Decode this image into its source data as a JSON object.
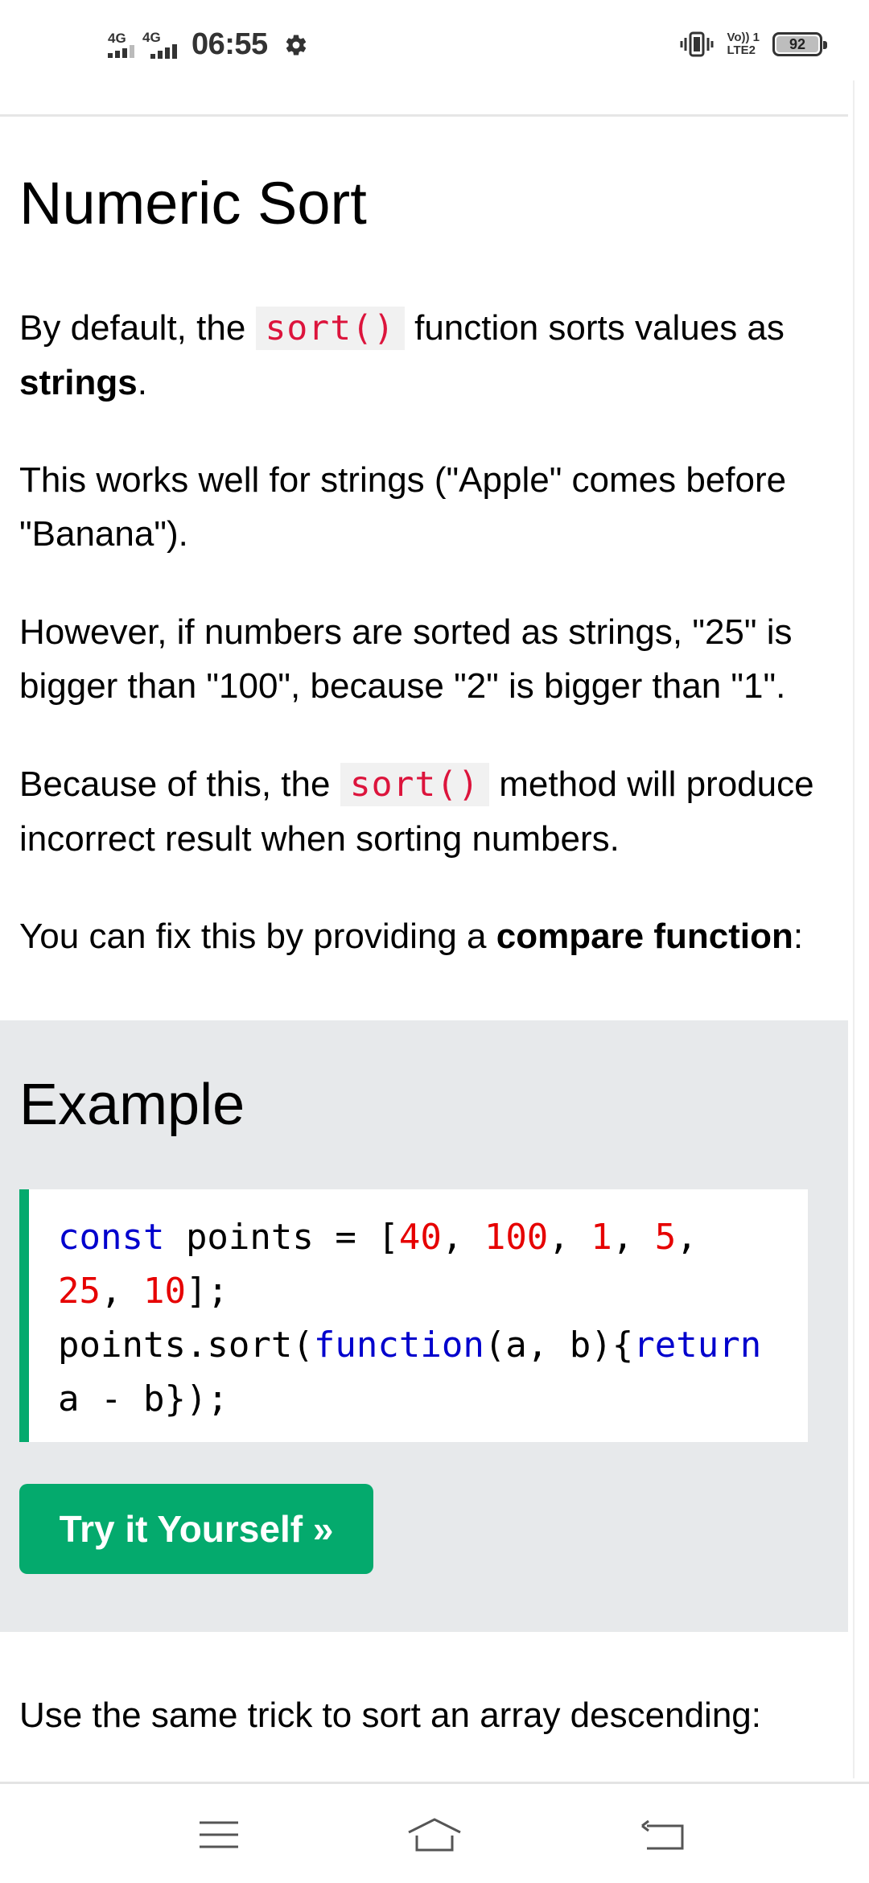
{
  "status_bar": {
    "network1": "4G",
    "network2": "4G",
    "time": "06:55",
    "volte": "Vo)) 1",
    "lte": "LTE2",
    "battery": "92"
  },
  "article": {
    "title": "Numeric Sort",
    "p1_before": "By default, the ",
    "p1_code": "sort()",
    "p1_after": " function sorts values as ",
    "p1_bold": "strings",
    "p1_end": ".",
    "p2": "This works well for strings (\"Apple\" comes before \"Banana\").",
    "p3": "However, if numbers are sorted as strings, \"25\" is bigger than \"100\", because \"2\" is bigger than \"1\".",
    "p4_before": "Because of this, the ",
    "p4_code": "sort()",
    "p4_after": " method will produce incorrect result when sorting numbers.",
    "p5_before": "You can fix this by providing a ",
    "p5_bold": "compare function",
    "p5_end": ":"
  },
  "example": {
    "heading": "Example",
    "code": {
      "kw_const": "const",
      "t_points": " points = [",
      "n40": "40",
      "c1": ", ",
      "n100": "100",
      "c2": ", ",
      "n1": "1",
      "c3": ", ",
      "n5": "5",
      "c4": ",",
      "n25": "25",
      "c5": ", ",
      "n10": "10",
      "t_end1": "];",
      "t_sort": "points.sort(",
      "kw_function": "function",
      "t_args": "(a, b){",
      "kw_return": "return",
      "t_tail": "a - b});"
    },
    "try_button": "Try it Yourself »"
  },
  "after_text": "Use the same trick to sort an array descending:",
  "nav": {
    "menu": "menu-icon",
    "home": "home-icon",
    "back": "back-icon"
  }
}
